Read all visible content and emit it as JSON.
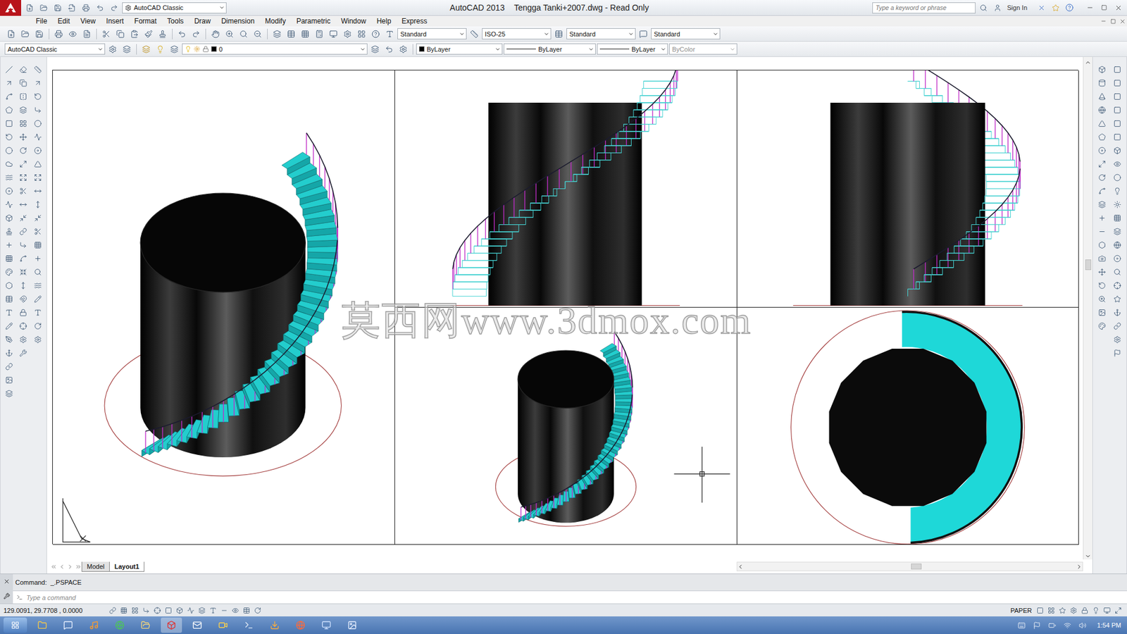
{
  "window": {
    "app": "AutoCAD 2013",
    "document": "Tengga Tanki+2007.dwg - Read Only",
    "workspace": "AutoCAD Classic"
  },
  "search": {
    "placeholder": "Type a keyword or phrase"
  },
  "account": {
    "label": "Sign In"
  },
  "menu": [
    "File",
    "Edit",
    "View",
    "Insert",
    "Format",
    "Tools",
    "Draw",
    "Dimension",
    "Modify",
    "Parametric",
    "Window",
    "Help",
    "Express"
  ],
  "styles_toolbar": [
    {
      "name": "text-style",
      "value": "Standard"
    },
    {
      "name": "dimension-style",
      "value": "ISO-25"
    },
    {
      "name": "table-style",
      "value": "Standard"
    },
    {
      "name": "multileader-style",
      "value": "Standard"
    }
  ],
  "properties_toolbar": {
    "workspace": "AutoCAD Classic",
    "layer": "0",
    "color": "ByLayer",
    "linetype": "ByLayer",
    "lineweight": "ByLayer",
    "plot_style": {
      "value": "ByColor",
      "disabled": true
    }
  },
  "viewports": [
    {
      "kind": "iso-large"
    },
    {
      "kind": "front"
    },
    {
      "kind": "side"
    },
    {
      "kind": "iso-small"
    },
    {
      "kind": "top"
    }
  ],
  "watermark": "莫西网www.3dmox.com",
  "layout_tabs": [
    {
      "label": "Model",
      "selected": false
    },
    {
      "label": "Layout1",
      "selected": true
    }
  ],
  "command": {
    "history": "Command:  _.PSPACE",
    "placeholder": "Type a command"
  },
  "status_bar": {
    "coordinates": "129.0091, 29.7708 , 0.0000",
    "space": "PAPER"
  },
  "taskbar": {
    "clock": "1:54 PM"
  }
}
